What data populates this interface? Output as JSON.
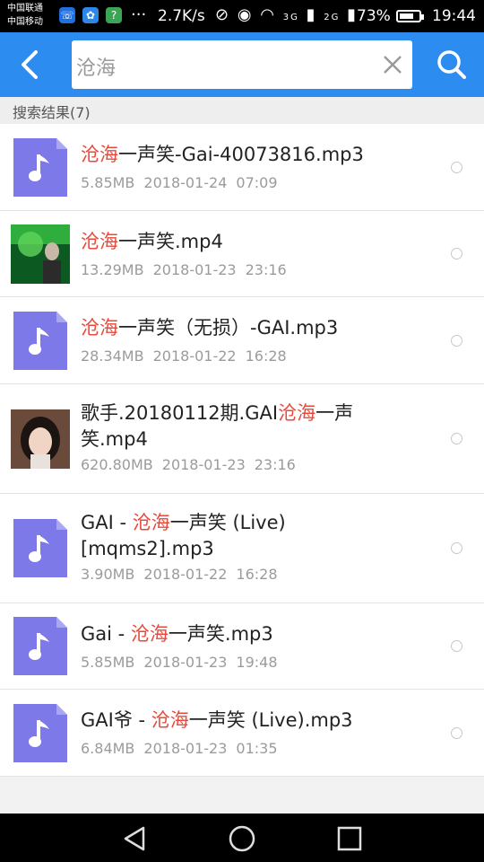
{
  "status_bar": {
    "carrier1": "中国联通",
    "carrier2": "中国移动",
    "dots": "···",
    "speed": "2.7K/s",
    "signal_labels": [
      "3G",
      "2G"
    ],
    "battery_pct": "73%",
    "battery_level": 0.73,
    "time": "19:44"
  },
  "header": {
    "query": "沧海",
    "back_icon": "chevron-left-icon",
    "clear_icon": "close-icon",
    "search_icon": "search-icon",
    "bg_color": "#2d8cf0"
  },
  "section": {
    "title": "搜索结果(7)"
  },
  "colors": {
    "highlight": "#e74a3c",
    "music_icon": "#7d79e9"
  },
  "results": [
    {
      "pre": "",
      "hl": "沧海",
      "post": "一声笑-Gai-40073816.mp3",
      "size": "5.85MB",
      "date": "2018-01-24",
      "time": "07:09",
      "thumb": "music"
    },
    {
      "pre": "",
      "hl": "沧海",
      "post": "一声笑.mp4",
      "size": "13.29MB",
      "date": "2018-01-23",
      "time": "23:16",
      "thumb": "video-green"
    },
    {
      "pre": "",
      "hl": "沧海",
      "post": "一声笑（无损）-GAI.mp3",
      "size": "28.34MB",
      "date": "2018-01-22",
      "time": "16:28",
      "thumb": "music"
    },
    {
      "pre": "歌手.20180112期.GAI",
      "hl": "沧海",
      "post": "一声笑.mp4",
      "size": "620.80MB",
      "date": "2018-01-23",
      "time": "23:16",
      "thumb": "video-face"
    },
    {
      "pre": "GAI - ",
      "hl": "沧海",
      "post": "一声笑 (Live)[mqms2].mp3",
      "size": "3.90MB",
      "date": "2018-01-22",
      "time": "16:28",
      "thumb": "music"
    },
    {
      "pre": "Gai - ",
      "hl": "沧海",
      "post": "一声笑.mp3",
      "size": "5.85MB",
      "date": "2018-01-23",
      "time": "19:48",
      "thumb": "music"
    },
    {
      "pre": "GAI爷 - ",
      "hl": "沧海",
      "post": "一声笑 (Live).mp3",
      "size": "6.84MB",
      "date": "2018-01-23",
      "time": "01:35",
      "thumb": "music"
    }
  ],
  "nav": {
    "back": "triangle-back-icon",
    "home": "circle-home-icon",
    "recent": "square-recent-icon"
  }
}
